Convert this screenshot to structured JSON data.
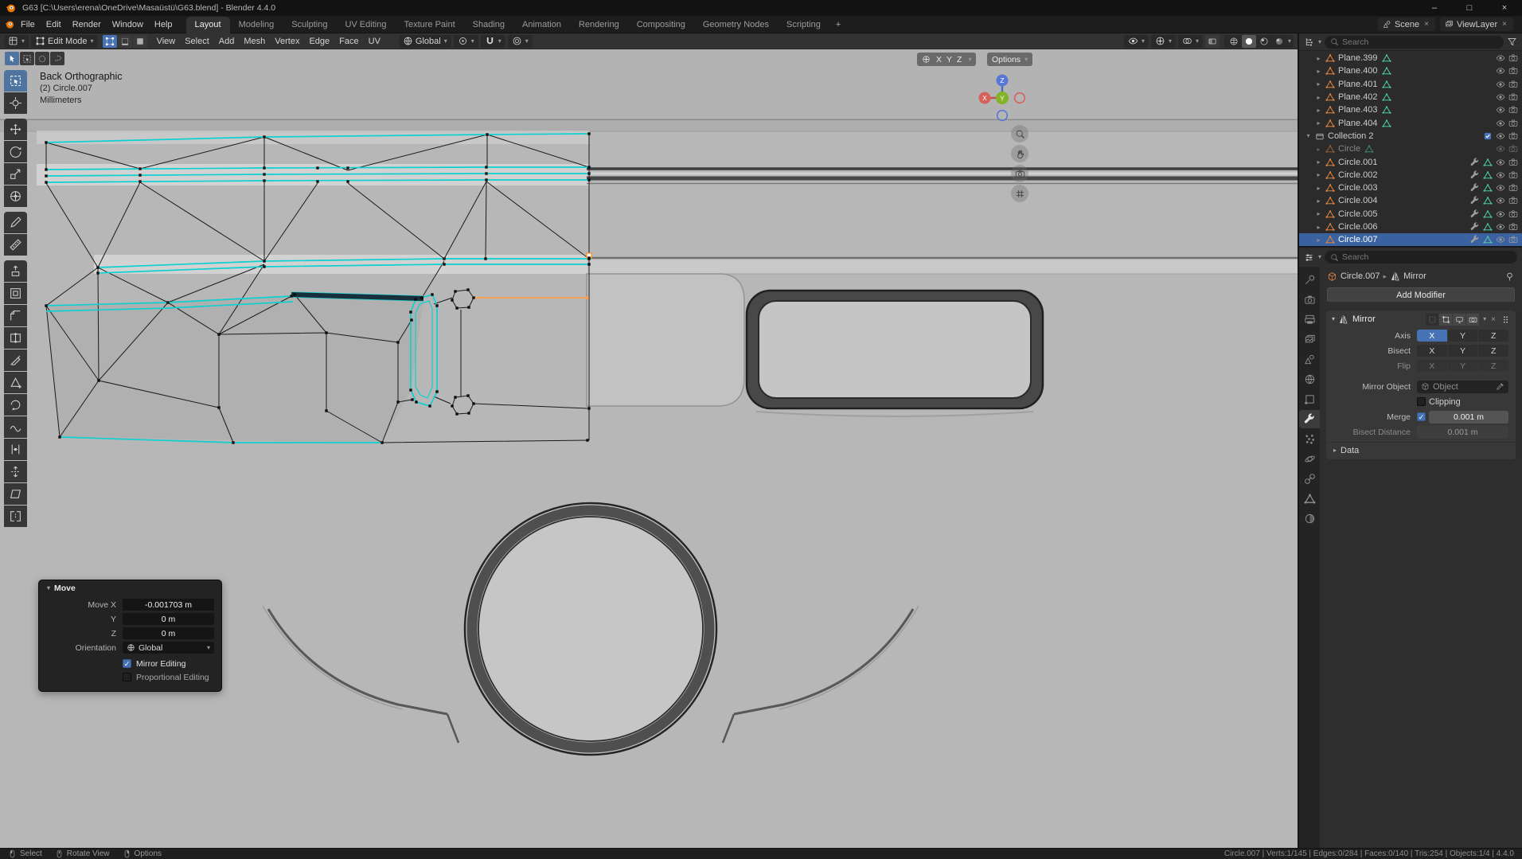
{
  "colors": {
    "accent": "#4772b3",
    "selected_edge_cyan": "#0fd0d0",
    "active_element_orange": "#ff9e4a",
    "object_icon_orange": "#e0823c",
    "mesh_data_teal": "#4ec9a5",
    "axis_x_red": "#d4615a",
    "axis_y_green": "#83b327",
    "axis_z_blue": "#5a77d6"
  },
  "glyphs": {
    "dropdown": "▾",
    "expander_open": "▾",
    "expander_closed": "▸",
    "breadcrumb_sep": "▸",
    "minimize": "–",
    "maximize": "□",
    "close": "×"
  },
  "window": {
    "title": "G63 [C:\\Users\\erena\\OneDrive\\Masaüstü\\G63.blend] - Blender 4.4.0"
  },
  "menubar": {
    "menus": [
      "File",
      "Edit",
      "Render",
      "Window",
      "Help"
    ],
    "workspaces": [
      "Layout",
      "Modeling",
      "Sculpting",
      "UV Editing",
      "Texture Paint",
      "Shading",
      "Animation",
      "Rendering",
      "Compositing",
      "Geometry Nodes",
      "Scripting"
    ],
    "active_workspace": "Layout",
    "add_workspace": "+",
    "scene": "Scene",
    "view_layer": "ViewLayer"
  },
  "viewport_header": {
    "mode": "Edit Mode",
    "menus": [
      "View",
      "Select",
      "Add",
      "Mesh",
      "Vertex",
      "Edge",
      "Face",
      "UV"
    ],
    "orientation": "Global"
  },
  "viewport": {
    "overlay": {
      "view": "Back Orthographic",
      "object": "(2) Circle.007",
      "units": "Millimeters"
    },
    "axis_chip": [
      "X",
      "Y",
      "Z"
    ],
    "options_chip": "Options",
    "gizmo": {
      "x": "X",
      "y": "Y",
      "z": "Z"
    },
    "select_tool_chips": [
      "tweak",
      "select-box",
      "select-circle",
      "select-lasso"
    ],
    "tools": [
      "select-box",
      "cursor-3d",
      "move",
      "rotate",
      "scale",
      "transform",
      "annotate",
      "measure",
      "extrude-region",
      "inset-faces",
      "bevel",
      "loop-cut",
      "knife",
      "poly-build",
      "spin",
      "smooth",
      "edge-slide",
      "shrink-fatten",
      "shear",
      "rip-region"
    ],
    "active_tool": "select-box"
  },
  "outliner": {
    "search_placeholder": "Search",
    "items": [
      {
        "name": "Plane.399",
        "type": "mesh",
        "indent": 1,
        "expander": "closed",
        "badges": [
          "meshdata"
        ],
        "right": [
          "eye",
          "camera"
        ]
      },
      {
        "name": "Plane.400",
        "type": "mesh",
        "indent": 1,
        "expander": "closed",
        "badges": [
          "meshdata"
        ],
        "right": [
          "eye",
          "camera"
        ]
      },
      {
        "name": "Plane.401",
        "type": "mesh",
        "indent": 1,
        "expander": "closed",
        "badges": [
          "meshdata"
        ],
        "right": [
          "eye",
          "camera"
        ]
      },
      {
        "name": "Plane.402",
        "type": "mesh",
        "indent": 1,
        "expander": "closed",
        "badges": [
          "meshdata"
        ],
        "right": [
          "eye",
          "camera"
        ]
      },
      {
        "name": "Plane.403",
        "type": "mesh",
        "indent": 1,
        "expander": "closed",
        "badges": [
          "meshdata"
        ],
        "right": [
          "eye",
          "camera"
        ]
      },
      {
        "name": "Plane.404",
        "type": "mesh",
        "indent": 1,
        "expander": "closed",
        "badges": [
          "meshdata"
        ],
        "right": [
          "eye",
          "camera"
        ]
      },
      {
        "name": "Collection 2",
        "type": "collection",
        "indent": 0,
        "expander": "open",
        "badges": [],
        "right": [
          "check",
          "eye",
          "camera"
        ]
      },
      {
        "name": "Circle",
        "type": "mesh",
        "indent": 1,
        "expander": "closed",
        "dimmed": true,
        "badges": [
          "meshdata"
        ],
        "right": [
          "eye",
          "camera"
        ]
      },
      {
        "name": "Circle.001",
        "type": "mesh",
        "indent": 1,
        "expander": "closed",
        "badges": [],
        "right": [
          "wrench",
          "meshdata",
          "eye",
          "camera"
        ]
      },
      {
        "name": "Circle.002",
        "type": "mesh",
        "indent": 1,
        "expander": "closed",
        "badges": [],
        "right": [
          "wrench",
          "meshdata",
          "eye",
          "camera"
        ]
      },
      {
        "name": "Circle.003",
        "type": "mesh",
        "indent": 1,
        "expander": "closed",
        "badges": [],
        "right": [
          "wrench",
          "meshdata",
          "eye",
          "camera"
        ]
      },
      {
        "name": "Circle.004",
        "type": "mesh",
        "indent": 1,
        "expander": "closed",
        "badges": [],
        "right": [
          "wrench",
          "meshdata",
          "eye",
          "camera"
        ]
      },
      {
        "name": "Circle.005",
        "type": "mesh",
        "indent": 1,
        "expander": "closed",
        "badges": [],
        "right": [
          "wrench",
          "meshdata",
          "eye",
          "camera"
        ]
      },
      {
        "name": "Circle.006",
        "type": "mesh",
        "indent": 1,
        "expander": "closed",
        "badges": [],
        "right": [
          "wrench",
          "meshdata",
          "eye",
          "camera"
        ]
      },
      {
        "name": "Circle.007",
        "type": "mesh",
        "indent": 1,
        "expander": "closed",
        "selected": true,
        "badges": [],
        "right": [
          "wrench",
          "meshdata",
          "eye",
          "camera"
        ]
      }
    ]
  },
  "properties": {
    "search_placeholder": "Search",
    "tabs": [
      "tool",
      "render",
      "output",
      "view-layer",
      "scene",
      "world",
      "object",
      "modifiers",
      "particles",
      "physics",
      "constraints",
      "object-data",
      "material"
    ],
    "active_tab": "modifiers",
    "breadcrumb": {
      "object": "Circle.007",
      "modifier": "Mirror"
    },
    "add_modifier": "Add Modifier",
    "modifier": {
      "name": "Mirror",
      "header_toggles": [
        {
          "icon": "toggle-cage",
          "on": false
        },
        {
          "icon": "toggle-edit",
          "on": true
        },
        {
          "icon": "toggle-realtime",
          "on": true
        },
        {
          "icon": "toggle-render",
          "on": true
        }
      ],
      "axis_label": "Axis",
      "bisect_label": "Bisect",
      "flip_label": "Flip",
      "axes": [
        "X",
        "Y",
        "Z"
      ],
      "axis_active": "X",
      "mirror_object_label": "Mirror Object",
      "mirror_object_placeholder": "Object",
      "clipping_label": "Clipping",
      "clipping_checked": false,
      "merge_label": "Merge",
      "merge_checked": true,
      "merge_value": "0.001 m",
      "bisect_distance_label": "Bisect Distance",
      "bisect_distance_value": "0.001 m",
      "data_label": "Data"
    }
  },
  "move_panel": {
    "title": "Move",
    "fields": [
      {
        "label": "Move X",
        "value": "-0.001703 m"
      },
      {
        "label": "Y",
        "value": "0 m"
      },
      {
        "label": "Z",
        "value": "0 m"
      }
    ],
    "orientation_label": "Orientation",
    "orientation_value": "Global",
    "checkboxes": [
      {
        "label": "Mirror Editing",
        "checked": true
      },
      {
        "label": "Proportional Editing",
        "checked": false
      }
    ]
  },
  "statusbar": {
    "hints": [
      {
        "icon": "mouse-left",
        "label": "Select"
      },
      {
        "icon": "mouse-middle",
        "label": "Rotate View"
      },
      {
        "icon": "mouse-right",
        "label": "Options"
      }
    ],
    "info": "Circle.007 | Verts:1/145 | Edges:0/284 | Faces:0/140 | Tris:254 | Objects:1/4 | 4.4.0"
  }
}
